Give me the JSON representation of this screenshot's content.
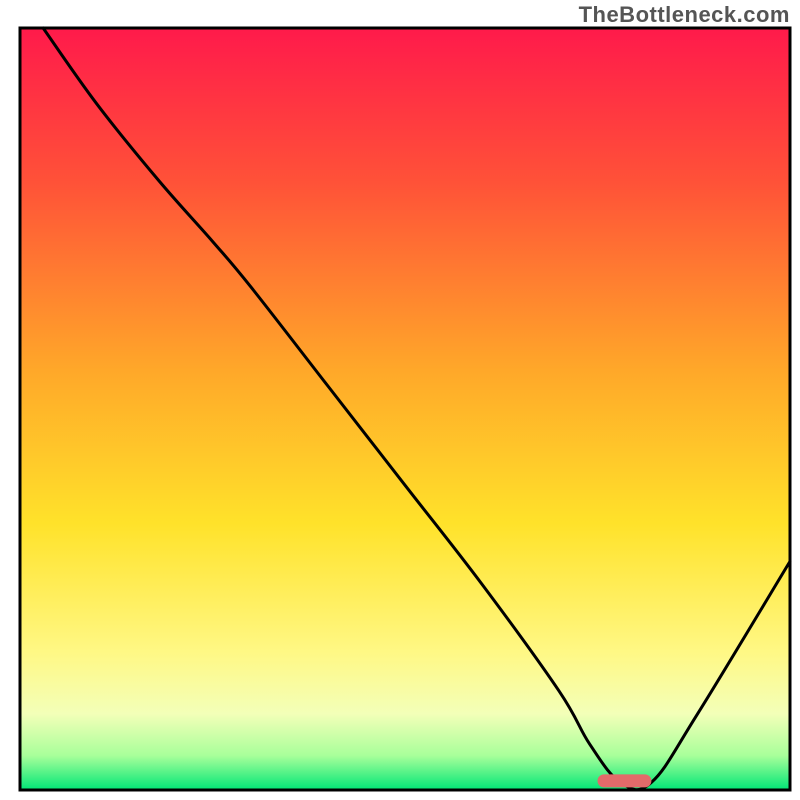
{
  "watermark": "TheBottleneck.com",
  "chart_data": {
    "type": "line",
    "title": "",
    "xlabel": "",
    "ylabel": "",
    "xlim": [
      0,
      100
    ],
    "ylim": [
      0,
      100
    ],
    "grid": false,
    "legend": false,
    "gradient_stops": [
      {
        "offset": 0.0,
        "color": "#ff1a4b"
      },
      {
        "offset": 0.2,
        "color": "#ff5138"
      },
      {
        "offset": 0.45,
        "color": "#ffa829"
      },
      {
        "offset": 0.65,
        "color": "#ffe22a"
      },
      {
        "offset": 0.82,
        "color": "#fff885"
      },
      {
        "offset": 0.9,
        "color": "#f3ffb8"
      },
      {
        "offset": 0.955,
        "color": "#a8ff9a"
      },
      {
        "offset": 1.0,
        "color": "#00e676"
      }
    ],
    "series": [
      {
        "name": "bottleneck-curve",
        "x": [
          3,
          10,
          18,
          25,
          30,
          40,
          50,
          60,
          70,
          74,
          78,
          82,
          88,
          100
        ],
        "y": [
          100,
          90,
          80,
          72,
          66,
          53,
          40,
          27,
          13,
          6,
          1,
          1,
          10,
          30
        ]
      }
    ],
    "marker": {
      "name": "optimal-range",
      "x_start": 75,
      "x_end": 82,
      "y": 1.2,
      "color": "#e26a6a"
    },
    "frame": {
      "inset_left": 20,
      "inset_top": 28,
      "inset_right": 10,
      "inset_bottom": 10,
      "stroke": "#000000",
      "stroke_width": 3
    }
  }
}
